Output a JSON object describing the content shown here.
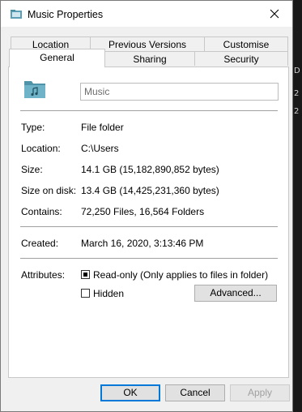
{
  "window": {
    "title": "Music Properties",
    "close_glyph": "✕"
  },
  "tabs_row1": [
    "Location",
    "Previous Versions",
    "Customise"
  ],
  "tabs_row2": [
    "General",
    "Sharing",
    "Security"
  ],
  "active_tab": "General",
  "general": {
    "folder_name": "Music",
    "type_label": "Type:",
    "type_value": "File folder",
    "location_label": "Location:",
    "location_value": "C:\\Users",
    "size_label": "Size:",
    "size_value": "14.1 GB (15,182,890,852 bytes)",
    "size_on_disk_label": "Size on disk:",
    "size_on_disk_value": "13.4 GB (14,425,231,360 bytes)",
    "contains_label": "Contains:",
    "contains_value": "72,250 Files, 16,564 Folders",
    "created_label": "Created:",
    "created_value": "March 16, 2020, 3:13:46 PM",
    "attributes_label": "Attributes:",
    "readonly_label": "Read-only (Only applies to files in folder)",
    "readonly_state": "indeterminate",
    "hidden_label": "Hidden",
    "hidden_checked": false,
    "advanced_label": "Advanced..."
  },
  "buttons": {
    "ok": "OK",
    "cancel": "Cancel",
    "apply": "Apply"
  },
  "colors": {
    "accent": "#0078d7",
    "folder": "#5a9fb5"
  },
  "background": {
    "partial_text": [
      "D",
      "2",
      "2"
    ]
  }
}
